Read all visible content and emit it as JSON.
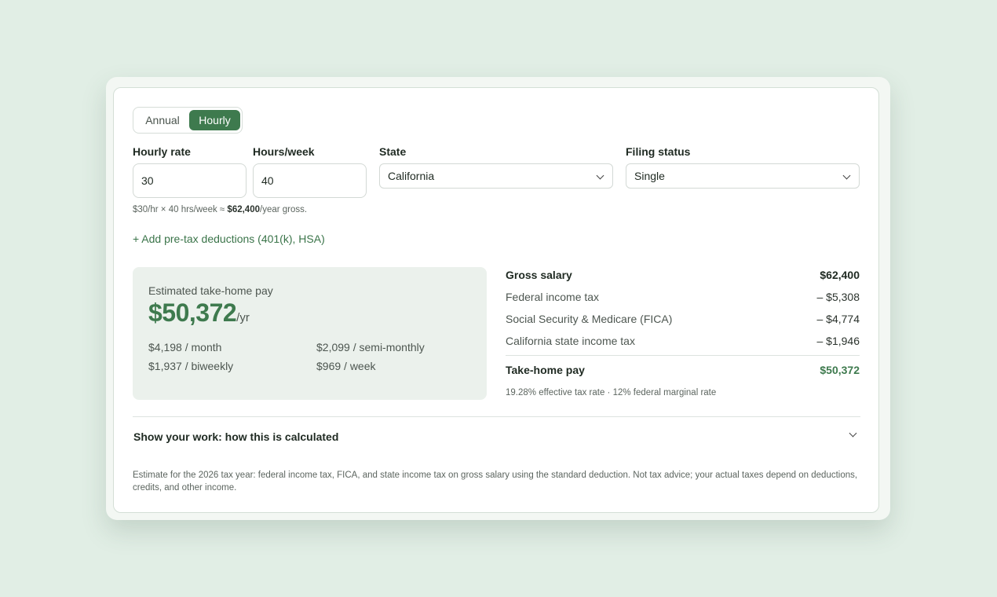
{
  "mode_toggle": {
    "annual_label": "Annual",
    "hourly_label": "Hourly",
    "selected": "Hourly"
  },
  "inputs": {
    "hourly_rate": {
      "label": "Hourly rate",
      "value": "30"
    },
    "hours_week": {
      "label": "Hours/week",
      "value": "40"
    },
    "state": {
      "label": "State",
      "value": "California"
    },
    "filing_status": {
      "label": "Filing status",
      "value": "Single"
    }
  },
  "gross_hint": {
    "prefix": "$30/hr × 40 hrs/week ≈ ",
    "amount": "$62,400",
    "suffix": "/year gross."
  },
  "add_deductions_label": "+ Add pre-tax deductions (401(k), HSA)",
  "result": {
    "caption": "Estimated take-home pay",
    "amount": "$50,372",
    "unit": "/yr",
    "monthly": "$4,198 / month",
    "semi_monthly": "$2,099 / semi-monthly",
    "biweekly": "$1,937 / biweekly",
    "weekly": "$969 / week"
  },
  "breakdown": {
    "gross": {
      "label": "Gross salary",
      "value": "$62,400"
    },
    "federal": {
      "label": "Federal income tax",
      "value": "– $5,308"
    },
    "fica": {
      "label": "Social Security & Medicare (FICA)",
      "value": "– $4,774"
    },
    "state": {
      "label": "California state income tax",
      "value": "– $1,946"
    },
    "take_home": {
      "label": "Take-home pay",
      "value": "$50,372"
    },
    "rates_note": "19.28% effective tax rate · 12% federal marginal rate"
  },
  "show_work_label": "Show your work: how this is calculated",
  "footnote": "Estimate for the 2026 tax year: federal income tax, FICA, and state income tax on gross salary using the standard deduction. Not tax advice; your actual taxes depend on deductions, credits, and other income.",
  "colors": {
    "accent": "#3e7a4e",
    "page_background": "#e1eee5",
    "result_panel": "#ebf1ec"
  }
}
